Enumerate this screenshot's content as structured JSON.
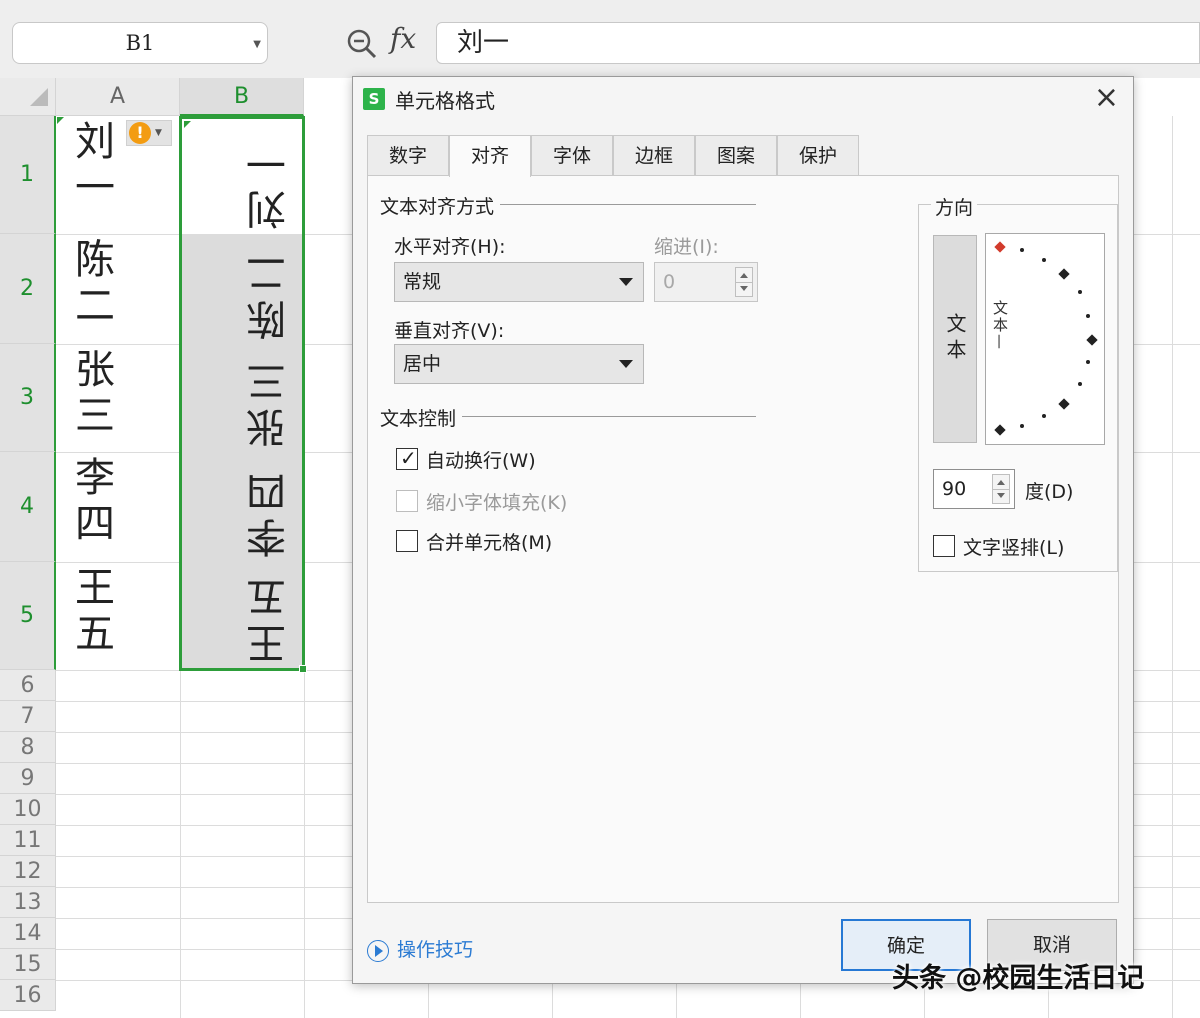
{
  "formula_bar": {
    "name_box": "B1",
    "fx_label": "fx",
    "formula_value": "刘一"
  },
  "sheet": {
    "columns": [
      "A",
      "B"
    ],
    "rows": [
      "1",
      "2",
      "3",
      "4",
      "5",
      "6",
      "7",
      "8",
      "9",
      "10",
      "11",
      "12",
      "13",
      "14",
      "15",
      "16"
    ],
    "column_a": [
      "刘一",
      "陈二",
      "张三",
      "李四",
      "王五"
    ],
    "column_b": [
      "刘一",
      "陈二",
      "张三",
      "李四",
      "王五"
    ],
    "warning_badge": "!"
  },
  "dialog": {
    "app_icon": "S",
    "title": "单元格格式",
    "close": "×",
    "tabs": [
      {
        "label": "数字"
      },
      {
        "label": "对齐"
      },
      {
        "label": "字体"
      },
      {
        "label": "边框"
      },
      {
        "label": "图案"
      },
      {
        "label": "保护"
      }
    ],
    "active_tab": "对齐",
    "text_alignment": {
      "section_title": "文本对齐方式",
      "horizontal_label": "水平对齐(H):",
      "horizontal_value": "常规",
      "indent_label": "缩进(I):",
      "indent_value": "0",
      "vertical_label": "垂直对齐(V):",
      "vertical_value": "居中"
    },
    "text_control": {
      "section_title": "文本控制",
      "wrap_text": {
        "label": "自动换行(W)",
        "checked": true
      },
      "shrink_to_fit": {
        "label": "缩小字体填充(K)",
        "checked": false,
        "disabled": true
      },
      "merge_cells": {
        "label": "合并单元格(M)",
        "checked": false
      }
    },
    "orientation": {
      "section_title": "方向",
      "vertical_text_button": "文本",
      "dial_text": "文本—",
      "degrees_value": "90",
      "degrees_label": "度(D)",
      "vertical_stack": {
        "label": "文字竖排(L)",
        "checked": false
      }
    },
    "tips_link": "操作技巧",
    "ok_button": "确定",
    "cancel_button": "取消"
  },
  "watermark": "头条 @校园生活日记",
  "colors": {
    "selection_green": "#2d9d3a",
    "accent_blue": "#2678d4",
    "warning_orange": "#f39c12",
    "dial_marker_red": "#d23b2c"
  }
}
